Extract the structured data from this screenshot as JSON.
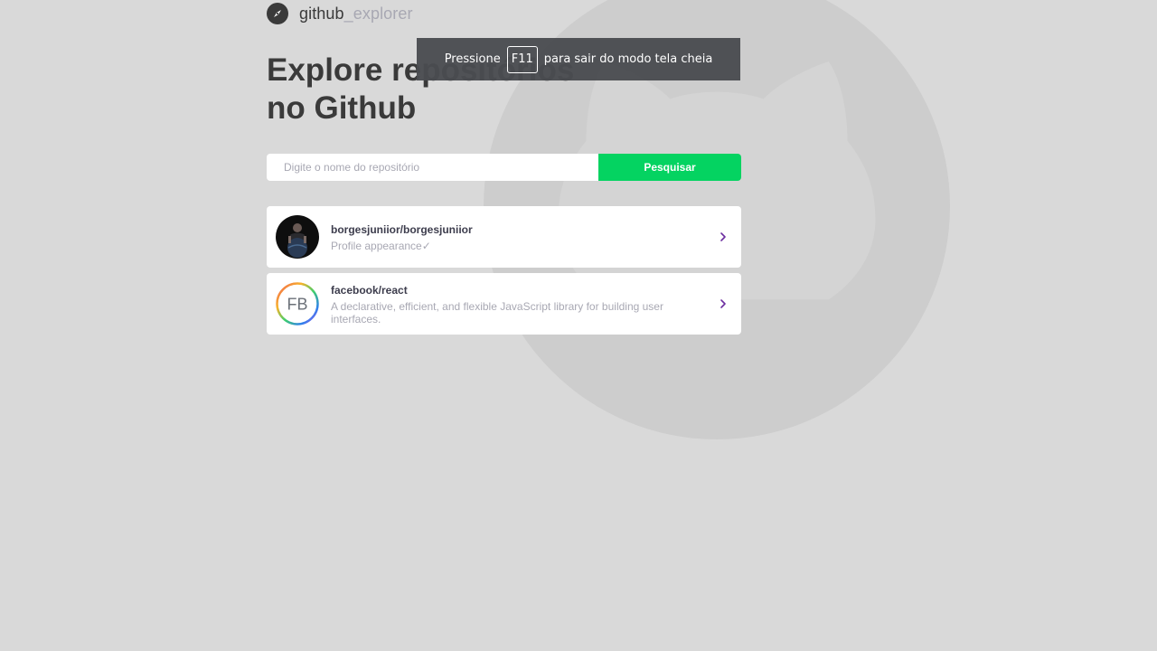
{
  "logo": {
    "name_main": "github",
    "name_accent": "_explorer"
  },
  "title": {
    "line1": "Explore repositórios",
    "line2": "no Github"
  },
  "search": {
    "placeholder": "Digite o nome do repositório",
    "value": "",
    "button_label": "Pesquisar"
  },
  "repositories": [
    {
      "full_name": "borgesjuniior/borgesjuniior",
      "description": "Profile appearance✓",
      "avatar": "user-photo-avatar"
    },
    {
      "full_name": "facebook/react",
      "description": "A declarative, efficient, and flexible JavaScript library for building user interfaces.",
      "avatar": "fb-logo-avatar"
    }
  ],
  "fullscreen_toast": {
    "prefix": "Pressione",
    "key": "F11",
    "suffix": "para sair do modo tela cheia"
  },
  "colors": {
    "background": "#d9d9d9",
    "title": "#3a3a3a",
    "accent_button": "#04d361",
    "muted_text": "#a8a8b3",
    "chevron": "#6c2ea0"
  },
  "icons": {
    "logo": "compass-icon",
    "chevron": "chevron-right-icon",
    "background": "github-octocat-watermark"
  }
}
